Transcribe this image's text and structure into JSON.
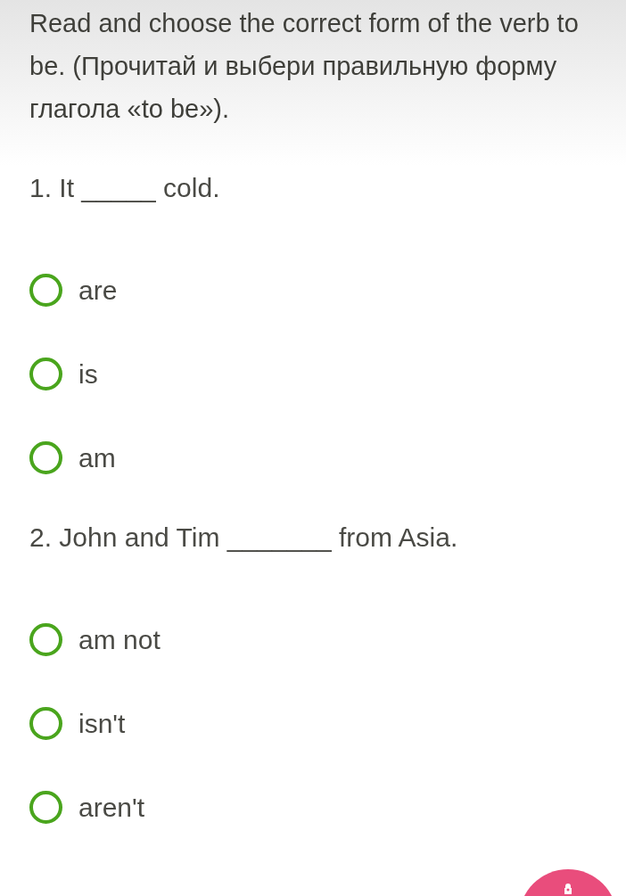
{
  "instruction": "Read and choose the correct form of the verb to be. (Прочитай и выбери правильную форму глагола «to be»).",
  "questions": [
    {
      "prompt": "1. It _____ cold.",
      "options": [
        {
          "label": "are",
          "selected": false
        },
        {
          "label": "is",
          "selected": false
        },
        {
          "label": "am",
          "selected": false
        }
      ]
    },
    {
      "prompt": "2. John and Tim _______ from Asia.",
      "options": [
        {
          "label": "am not",
          "selected": false
        },
        {
          "label": "isn't",
          "selected": false
        },
        {
          "label": "aren't",
          "selected": false
        }
      ]
    }
  ]
}
